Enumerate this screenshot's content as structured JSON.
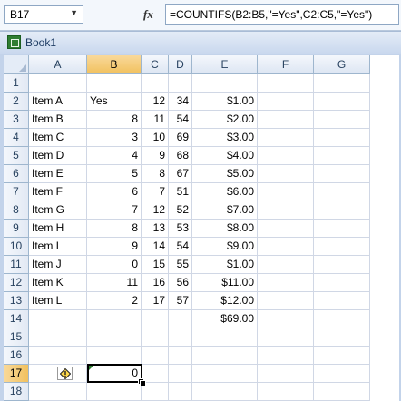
{
  "formula_bar": {
    "name_box": "B17",
    "fx_label": "fx",
    "formula": "=COUNTIFS(B2:B5,\"=Yes\",C2:C5,\"=Yes\")"
  },
  "workbook": {
    "title": "Book1"
  },
  "columns": [
    "A",
    "B",
    "C",
    "D",
    "E",
    "F",
    "G"
  ],
  "rows": [
    {
      "n": "1",
      "A": "",
      "B": "",
      "C": "",
      "D": "",
      "E": ""
    },
    {
      "n": "2",
      "A": "Item A",
      "B": "Yes",
      "C": "12",
      "D": "34",
      "E": "$1.00"
    },
    {
      "n": "3",
      "A": "Item B",
      "B": "8",
      "C": "11",
      "D": "54",
      "E": "$2.00"
    },
    {
      "n": "4",
      "A": "Item C",
      "B": "3",
      "C": "10",
      "D": "69",
      "E": "$3.00"
    },
    {
      "n": "5",
      "A": "Item D",
      "B": "4",
      "C": "9",
      "D": "68",
      "E": "$4.00"
    },
    {
      "n": "6",
      "A": "Item E",
      "B": "5",
      "C": "8",
      "D": "67",
      "E": "$5.00"
    },
    {
      "n": "7",
      "A": "Item F",
      "B": "6",
      "C": "7",
      "D": "51",
      "E": "$6.00"
    },
    {
      "n": "8",
      "A": "Item G",
      "B": "7",
      "C": "12",
      "D": "52",
      "E": "$7.00"
    },
    {
      "n": "9",
      "A": "Item H",
      "B": "8",
      "C": "13",
      "D": "53",
      "E": "$8.00"
    },
    {
      "n": "10",
      "A": "Item I",
      "B": "9",
      "C": "14",
      "D": "54",
      "E": "$9.00"
    },
    {
      "n": "11",
      "A": "Item J",
      "B": "0",
      "C": "15",
      "D": "55",
      "E": "$1.00"
    },
    {
      "n": "12",
      "A": "Item K",
      "B": "11",
      "C": "16",
      "D": "56",
      "E": "$11.00"
    },
    {
      "n": "13",
      "A": "Item L",
      "B": "2",
      "C": "17",
      "D": "57",
      "E": "$12.00"
    },
    {
      "n": "14",
      "A": "",
      "B": "",
      "C": "",
      "D": "",
      "E": "$69.00"
    },
    {
      "n": "15",
      "A": "",
      "B": "",
      "C": "",
      "D": "",
      "E": ""
    },
    {
      "n": "16",
      "A": "",
      "B": "",
      "C": "",
      "D": "",
      "E": ""
    },
    {
      "n": "17",
      "A": "",
      "B": "0",
      "C": "",
      "D": "",
      "E": ""
    },
    {
      "n": "18",
      "A": "",
      "B": "",
      "C": "",
      "D": "",
      "E": ""
    }
  ],
  "selection": {
    "column": "B",
    "row": "17"
  },
  "icons": [
    "dropdown-arrow-icon",
    "fx-icon",
    "excel-workbook-icon",
    "error-warning-icon",
    "fill-handle-icon"
  ],
  "colors": {
    "selected_header": "#f1c15f",
    "gridline": "#d0d7e5",
    "header_border": "#9eb6ce"
  }
}
